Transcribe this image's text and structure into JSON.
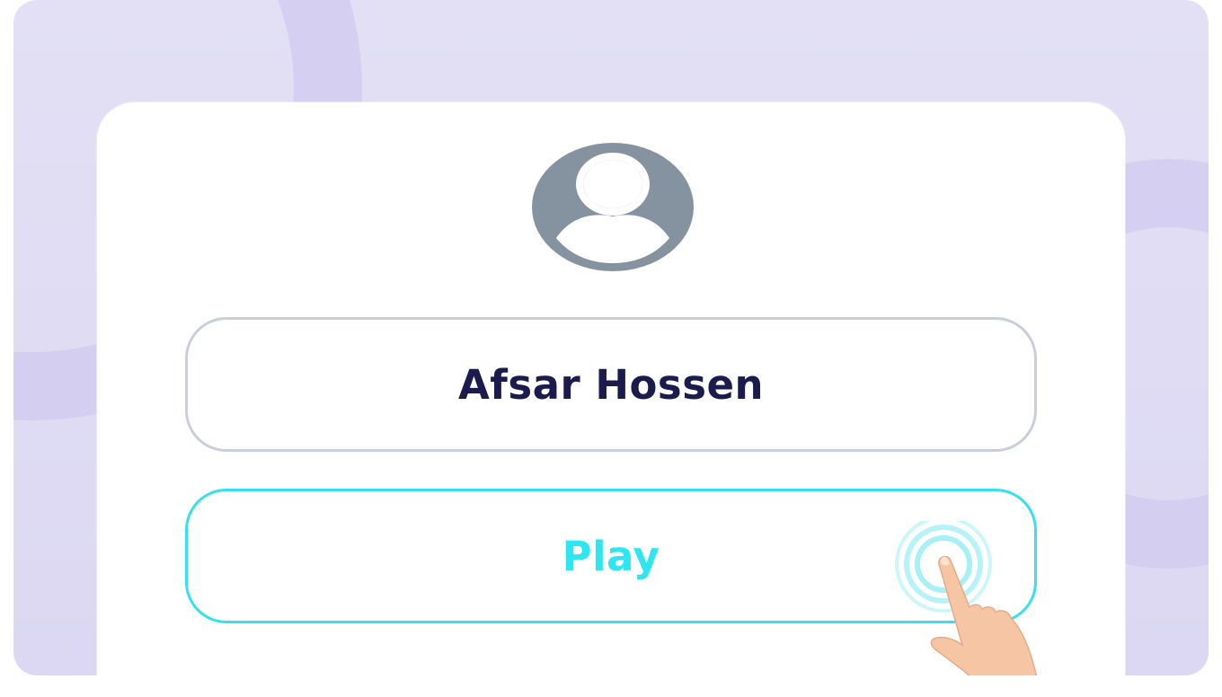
{
  "profile": {
    "avatar_icon": "user-avatar-icon",
    "name": "Afsar Hossen"
  },
  "actions": {
    "play_label": "Play"
  },
  "pointer": {
    "icon": "tap-hand-icon"
  },
  "colors": {
    "background": "#e1def5",
    "card": "#ffffff",
    "avatar": "#8593a1",
    "name_text": "#1c1b4d",
    "field_border": "#c9ced8",
    "accent": "#35e0f0"
  }
}
